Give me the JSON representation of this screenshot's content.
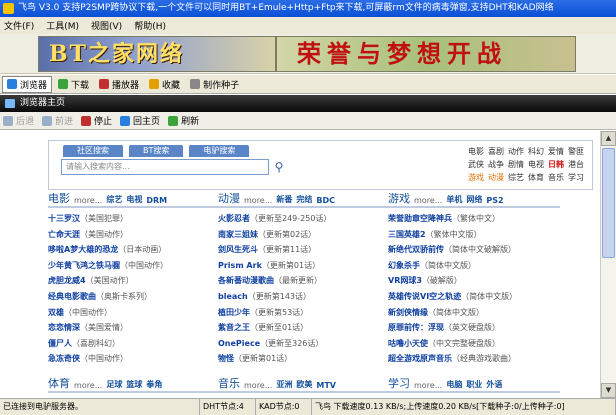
{
  "window": {
    "title": "飞鸟 V3.0 支持P2SMP跨协议下载,一个文件可以同时用BT+Emule+Http+Ftp来下载,可屏蔽rm文件的病毒弹窗,支持DHT和KAD网络"
  },
  "menu": [
    "文件(F)",
    "工具(M)",
    "视图(V)",
    "帮助(H)"
  ],
  "banner": {
    "logo": "BT之家网络",
    "slogan": "荣誉与梦想开战"
  },
  "toolbar": [
    {
      "label": "浏览器",
      "icon": "browser-icon",
      "color": "#2a7ee0"
    },
    {
      "label": "下载",
      "icon": "download-icon",
      "color": "#3aa33a"
    },
    {
      "label": "播放器",
      "icon": "player-icon",
      "color": "#c03030"
    },
    {
      "label": "收藏",
      "icon": "favorite-icon",
      "color": "#e0a000"
    },
    {
      "label": "制作种子",
      "icon": "seed-icon",
      "color": "#888888"
    }
  ],
  "panel": {
    "title": "浏览器主页"
  },
  "nav": [
    {
      "label": "后退",
      "icon": "back-icon",
      "disabled": true
    },
    {
      "label": "前进",
      "icon": "forward-icon",
      "disabled": true
    },
    {
      "label": "停止",
      "icon": "stop-icon",
      "disabled": false
    },
    {
      "label": "回主页",
      "icon": "home-icon",
      "disabled": false
    },
    {
      "label": "刷新",
      "icon": "refresh-icon",
      "disabled": false
    }
  ],
  "search": {
    "tabs": [
      "社区搜索",
      "BT搜索",
      "电驴搜索"
    ],
    "placeholder": "请输入搜索内容..."
  },
  "categories": [
    [
      "电影",
      "喜剧",
      "动作",
      "科幻",
      "爱情",
      "警匪"
    ],
    [
      "武侠",
      "战争",
      "剧情",
      "电视",
      "日韩",
      "港台"
    ],
    [
      "游戏",
      "动漫",
      "综艺",
      "体育",
      "音乐",
      "学习"
    ]
  ],
  "sections": [
    {
      "title": "电影",
      "more": "more...",
      "subs": [
        "综艺",
        "电视",
        "DRM"
      ],
      "items": [
        [
          "十三罗汉",
          "（美国犯罪）"
        ],
        [
          "亡命天涯",
          "（美国动作）"
        ],
        [
          "哆啦A梦大雄的恐龙",
          "（日本动画）"
        ],
        [
          "少年黄飞鸿之铁马骝",
          "（中国动作）"
        ],
        [
          "虎胆龙威4",
          "（美国动作）"
        ],
        [
          "经典电影歌曲",
          "（奥斯卡系列）"
        ],
        [
          "双雄",
          "（中国动作）"
        ],
        [
          "恋恋情深",
          "（美国爱情）"
        ],
        [
          "僵尸人",
          "（喜剧科幻）"
        ],
        [
          "急冻奇侠",
          "（中国动作）"
        ]
      ]
    },
    {
      "title": "动漫",
      "more": "more...",
      "subs": [
        "新番",
        "完结",
        "BDC"
      ],
      "items": [
        [
          "火影忍者",
          "（更新至249-250话）"
        ],
        [
          "南家三姐妹",
          "（更新第02话）"
        ],
        [
          "剑风生死斗",
          "（更新第11话）"
        ],
        [
          "Prism Ark",
          "（更新第01话）"
        ],
        [
          "各新番动漫歌曲",
          "（最新更新）"
        ],
        [
          "bleach",
          "（更新第143话）"
        ],
        [
          "植田少年",
          "（更新第53话）"
        ],
        [
          "紫音之王",
          "（更新至01话）"
        ],
        [
          "OnePiece",
          "（更新至326话）"
        ],
        [
          "物怪",
          "（更新第01话）"
        ]
      ]
    },
    {
      "title": "游戏",
      "more": "more...",
      "subs": [
        "单机",
        "网络",
        "PS2"
      ],
      "items": [
        [
          "荣誉勋章空降神兵",
          "（繁体中文）"
        ],
        [
          "三国英雄2",
          "（繁体中文版）"
        ],
        [
          "新绝代双骄前传",
          "（简体中文破解版）"
        ],
        [
          "幻象杀手",
          "（简体中文版）"
        ],
        [
          "VR网球3",
          "（破解版）"
        ],
        [
          "英雄传说VI空之轨迹",
          "（简体中文版）"
        ],
        [
          "新剑侠情缘",
          "（简体中文版）"
        ],
        [
          "原罪前传：浮现",
          "（英文硬盘版）"
        ],
        [
          "咕噜小天使",
          "（中文完整硬盘版）"
        ],
        [
          "超全游戏原声音乐",
          "（经典游戏歌曲）"
        ]
      ]
    },
    {
      "title": "体育",
      "more": "more...",
      "subs": [
        "足球",
        "篮球",
        "拳角"
      ]
    },
    {
      "title": "音乐",
      "more": "more...",
      "subs": [
        "亚洲",
        "欧美",
        "MTV"
      ]
    },
    {
      "title": "学习",
      "more": "more...",
      "subs": [
        "电脑",
        "职业",
        "外语"
      ]
    }
  ],
  "status": [
    "已连接到电驴服务器。",
    "DHT节点:4",
    "KAD节点:0",
    "飞鸟 下载速度0.13 KB/s;上传速度0.20 KB/s[下载种子:0/上传种子:0]"
  ]
}
